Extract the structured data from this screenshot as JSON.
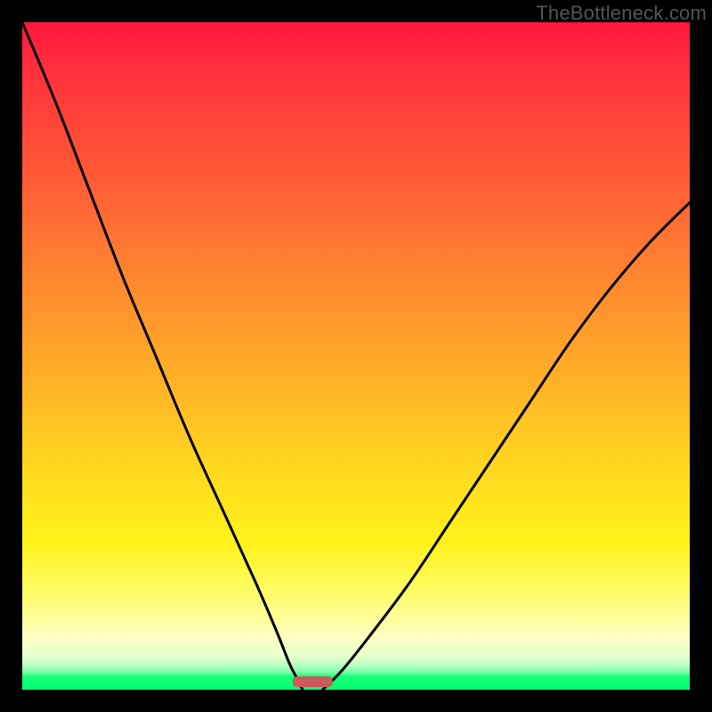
{
  "watermark": "TheBottleneck.com",
  "chart_data": {
    "type": "line",
    "title": "",
    "xlabel": "",
    "ylabel": "",
    "xlim": [
      0,
      100
    ],
    "ylim": [
      0,
      100
    ],
    "notes": "V-shaped bottleneck curve with minimum near x≈42; left branch steeper than right. Background is a vertical gradient from red (top, high bottleneck) through orange/yellow to a thin green band at the bottom (low/no bottleneck). A small rounded marker sits at the minimum.",
    "series": [
      {
        "name": "curve-left",
        "x": [
          0,
          5,
          10,
          15,
          20,
          25,
          30,
          35,
          38,
          40,
          41,
          42
        ],
        "y": [
          100,
          88,
          75,
          62,
          50,
          38,
          27,
          16,
          9,
          4,
          2,
          0
        ]
      },
      {
        "name": "curve-right",
        "x": [
          45,
          48,
          52,
          58,
          64,
          70,
          76,
          82,
          88,
          94,
          100
        ],
        "y": [
          0,
          3,
          8,
          16,
          25,
          34,
          43,
          52,
          60,
          67,
          73
        ]
      }
    ],
    "marker": {
      "x": 43.5,
      "y": 1.2,
      "width": 6,
      "height": 1.6,
      "color": "#cc5a5a"
    },
    "gradient_stops": [
      {
        "pos": 0,
        "color": "#ff173f"
      },
      {
        "pos": 50,
        "color": "#ffb226"
      },
      {
        "pos": 80,
        "color": "#fff21a"
      },
      {
        "pos": 95,
        "color": "#e8ffcf"
      },
      {
        "pos": 100,
        "color": "#00ff6f"
      }
    ]
  }
}
